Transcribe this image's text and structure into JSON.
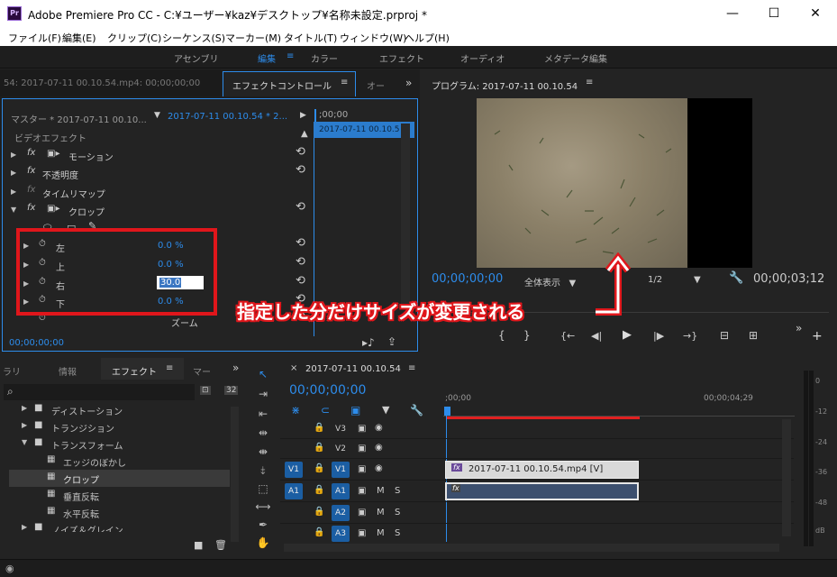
{
  "window": {
    "title": "Adobe Premiere Pro CC - C:¥ユーザー¥kaz¥デスクトップ¥名称未設定.prproj *",
    "app_icon": "Pr",
    "minimize": "—",
    "maximize": "☐",
    "close": "✕"
  },
  "menu": [
    "ファイル(F)",
    "編集(E)",
    "クリップ(C)",
    "シーケンス(S)",
    "マーカー(M)",
    "タイトル(T)",
    "ウィンドウ(W)",
    "ヘルプ(H)"
  ],
  "workspaces": [
    "アセンブリ",
    "編集",
    "カラー",
    "エフェクト",
    "オーディオ",
    "メタデータ編集"
  ],
  "workspace_menu": "≡",
  "source_tab": "54: 2017-07-11 00.10.54.mp4: 00;00;00;00",
  "effect_controls": {
    "tab": "エフェクトコントロール",
    "tab_menu": "≡",
    "tab_next": "オー",
    "more": "»",
    "master": "マスター * 2017-07-11 00.10...",
    "clip": "2017-07-11 00.10.54 * 2...",
    "timecode_head": ";00;00",
    "clip_bar": "2017-07-11 00.10.5",
    "section": "ビデオエフェクト",
    "effects": [
      "モーション",
      "不透明度",
      "タイムリマップ",
      "クロップ"
    ],
    "props": [
      {
        "name": "左",
        "value": "0.0 %"
      },
      {
        "name": "上",
        "value": "0.0 %"
      },
      {
        "name": "右",
        "value": "30.0"
      },
      {
        "name": "下",
        "value": "0.0 %"
      }
    ],
    "zoom_label": "ズーム",
    "timecode": "00;00;00;00"
  },
  "program": {
    "title": "プログラム: 2017-07-11 00.10.54",
    "menu": "≡",
    "timecode": "00;00;00;00",
    "fit": "全体表示",
    "quality": "1/2",
    "duration": "00;00;03;12",
    "transport": [
      "{",
      "}",
      "{←",
      "◀|",
      "▶",
      "|▶",
      "→}"
    ]
  },
  "annotation": {
    "text": "指定した分だけサイズが変更される"
  },
  "project": {
    "tabs": [
      "ラリ",
      "情報",
      "エフェクト",
      "マー"
    ],
    "tab_menu": "≡",
    "more": "»",
    "search_icon": "⌕",
    "items": [
      {
        "label": "ディストーション",
        "type": "folder",
        "open": false
      },
      {
        "label": "トランジション",
        "type": "folder",
        "open": false
      },
      {
        "label": "トランスフォーム",
        "type": "folder",
        "open": true
      },
      {
        "label": "エッジのぼかし",
        "type": "effect"
      },
      {
        "label": "クロップ",
        "type": "effect",
        "selected": true
      },
      {
        "label": "垂直反転",
        "type": "effect"
      },
      {
        "label": "水平反転",
        "type": "effect"
      },
      {
        "label": "ノイズ＆グレイン",
        "type": "folder",
        "open": false
      }
    ]
  },
  "timeline": {
    "close": "×",
    "tab": "2017-07-11 00.10.54",
    "menu": "≡",
    "timecode": "00;00;00;00",
    "ruler_start": ";00;00",
    "ruler_end": "00;00;04;29",
    "tracks": [
      {
        "src": "",
        "name": "V3",
        "kind": "video"
      },
      {
        "src": "",
        "name": "V2",
        "kind": "video"
      },
      {
        "src": "V1",
        "name": "V1",
        "kind": "video"
      },
      {
        "src": "A1",
        "name": "A1",
        "kind": "audio"
      },
      {
        "src": "",
        "name": "A2",
        "kind": "audio"
      },
      {
        "src": "",
        "name": "A3",
        "kind": "audio"
      }
    ],
    "video_clip": "2017-07-11 00.10.54.mp4 [V]",
    "fx_badge": "fx"
  },
  "meter": {
    "labels": [
      "0",
      "-12",
      "-24",
      "-36",
      "-48",
      "dB"
    ]
  },
  "colors": {
    "accent": "#2d8ceb",
    "highlight_red": "#e0161b",
    "playhead_red": "#e02020",
    "track_blue": "#1b5ea3"
  }
}
